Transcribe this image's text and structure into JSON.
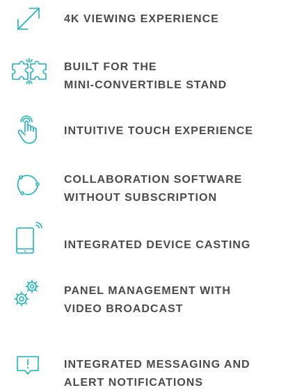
{
  "accent_color": "#18b2c2",
  "text_color": "#4a4a4a",
  "features": [
    {
      "icon": "expand-icon",
      "lines": [
        "4K VIEWING EXPERIENCE"
      ]
    },
    {
      "icon": "puzzle-icon",
      "lines": [
        "BUILT FOR THE",
        "MINI-CONVERTIBLE STAND"
      ]
    },
    {
      "icon": "touch-hand-icon",
      "lines": [
        "INTUITIVE TOUCH EXPERIENCE"
      ]
    },
    {
      "icon": "collaboration-icon",
      "lines": [
        "COLLABORATION SOFTWARE",
        "WITHOUT SUBSCRIPTION"
      ]
    },
    {
      "icon": "device-casting-icon",
      "lines": [
        "INTEGRATED DEVICE CASTING"
      ]
    },
    {
      "icon": "gears-icon",
      "lines": [
        "PANEL MANAGEMENT WITH",
        "VIDEO BROADCAST"
      ]
    },
    {
      "icon": "alert-message-icon",
      "lines": [
        "INTEGRATED MESSAGING AND",
        "ALERT NOTIFICATIONS"
      ]
    }
  ]
}
